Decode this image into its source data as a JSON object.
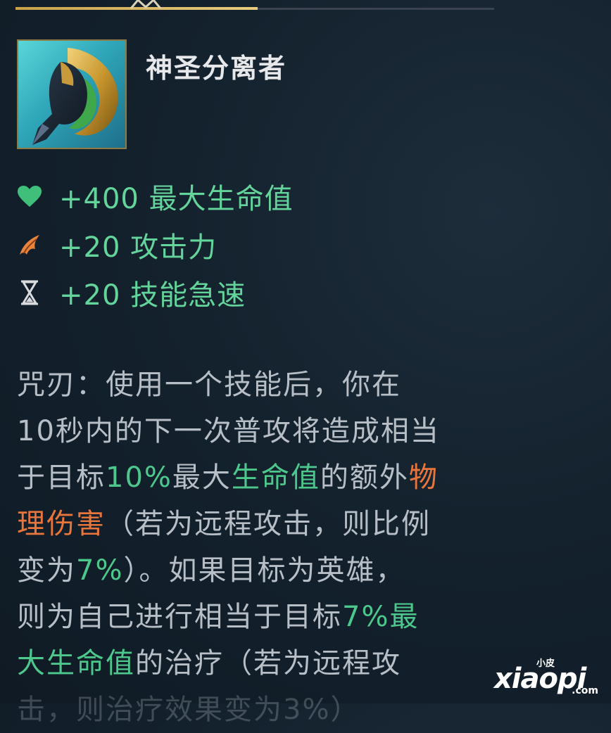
{
  "item": {
    "name": "神圣分离者",
    "icon": "divine-sunderer-item-icon"
  },
  "stats": [
    {
      "icon": "heart-icon",
      "text": "+400 最大生命值",
      "color": "#3fbf7a"
    },
    {
      "icon": "attack-damage-icon",
      "text": "+20 攻击力",
      "color": "#e8843c"
    },
    {
      "icon": "hourglass-icon",
      "text": "+20 技能急速",
      "color": "#d8dadc"
    }
  ],
  "description": {
    "l1": "咒刃：使用一个技能后，你在",
    "l2": "10秒内的下一次普攻将造成相当",
    "l3a": "于目标",
    "l3b": "10%",
    "l3c": "最大",
    "l3d": "生命值",
    "l3e": "的额外",
    "l3f": "物",
    "l4a": "理伤害",
    "l4b": "（若为远程攻击，则比例",
    "l5a": "变为",
    "l5b": "7%",
    "l5c": "）。如果目标为英雄，",
    "l6a": "则为自己进行相当于目标",
    "l6b": "7%最",
    "l7a": "大生命值",
    "l7b": "的治疗（若为远程攻",
    "l8": "击，则治疗效果变为3%）"
  },
  "watermark": {
    "small": "小皮",
    "big": "xiaopi",
    "domain": ".com"
  },
  "colors": {
    "highlight_green": "#4dc88d",
    "highlight_orange": "#e8763c",
    "body_text": "#b8bec6",
    "tab_active": "#c9a24a"
  }
}
